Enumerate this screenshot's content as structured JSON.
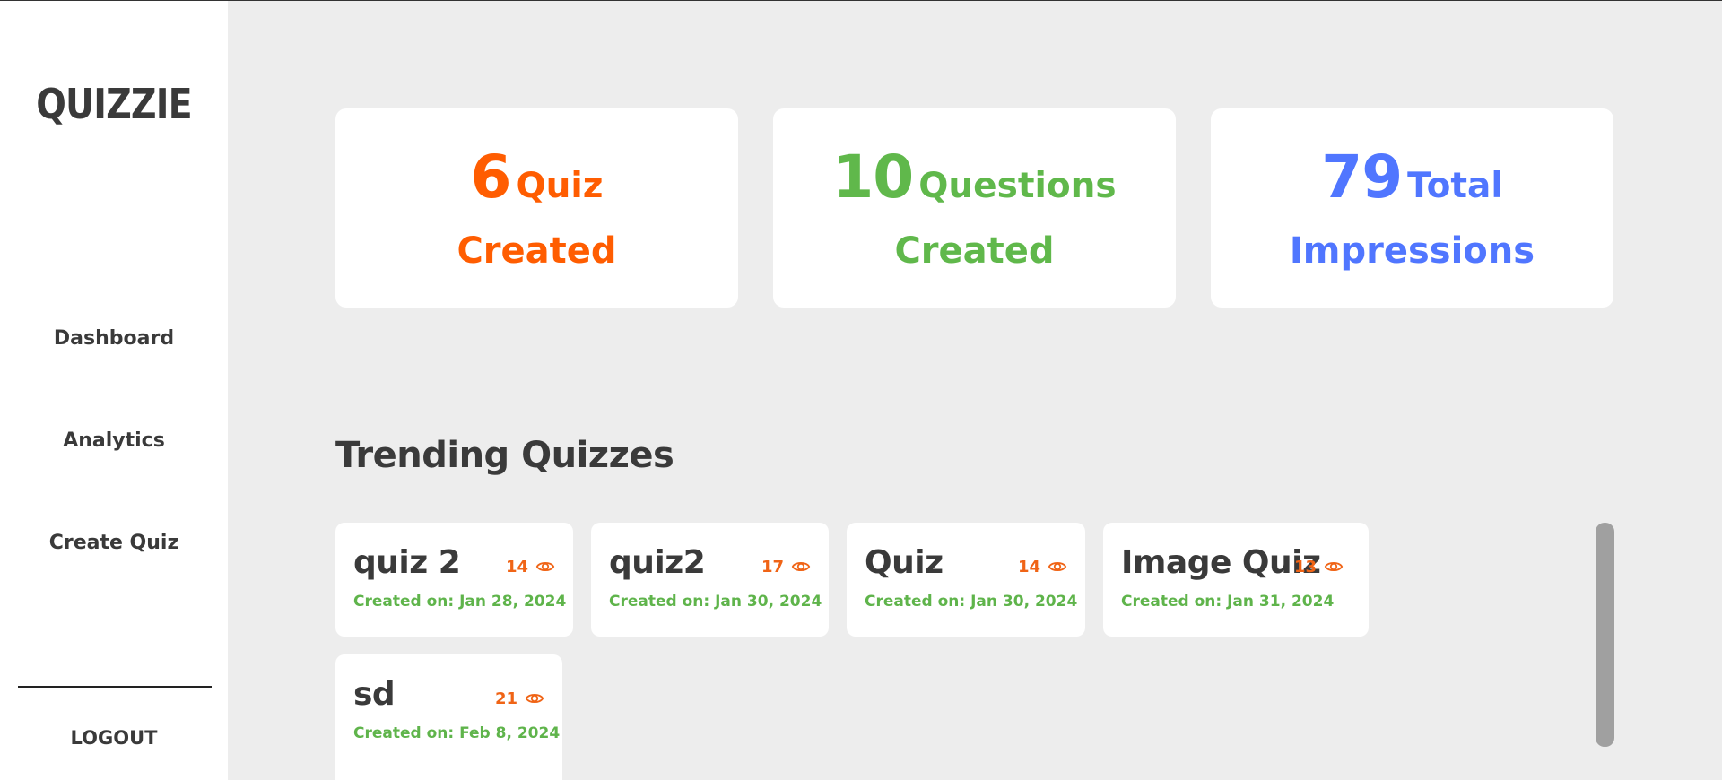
{
  "app": {
    "logo": "QUIZZIE"
  },
  "sidebar": {
    "items": [
      {
        "label": "Dashboard"
      },
      {
        "label": "Analytics"
      },
      {
        "label": "Create Quiz"
      }
    ],
    "logout_label": "LOGOUT"
  },
  "stats": [
    {
      "number": "6",
      "word": "Quiz",
      "caption": "Created",
      "color": "#ff5d01"
    },
    {
      "number": "10",
      "word": "Questions",
      "caption": "Created",
      "color": "#60b84b"
    },
    {
      "number": "79",
      "word": "Total",
      "caption": "Impressions",
      "color": "#5076ff"
    }
  ],
  "trending": {
    "title": "Trending Quizzes",
    "quizzes": [
      {
        "name": "quiz 2",
        "views": "14",
        "date": "Created on: Jan 28, 2024"
      },
      {
        "name": "quiz2",
        "views": "17",
        "date": "Created on: Jan 30, 2024"
      },
      {
        "name": "Quiz",
        "views": "14",
        "date": "Created on: Jan 30, 2024"
      },
      {
        "name": "Image Quiz",
        "views": "13",
        "date": "Created on: Jan 31, 2024"
      },
      {
        "name": "sd",
        "views": "21",
        "date": "Created on: Feb 8, 2024"
      }
    ]
  },
  "colors": {
    "background": "#ededed",
    "sidebar": "#ffffff",
    "text": "#3a3a3a",
    "views": "#f06416",
    "date": "#5fb44b"
  },
  "icons": {
    "views_icon": "eye-icon"
  }
}
